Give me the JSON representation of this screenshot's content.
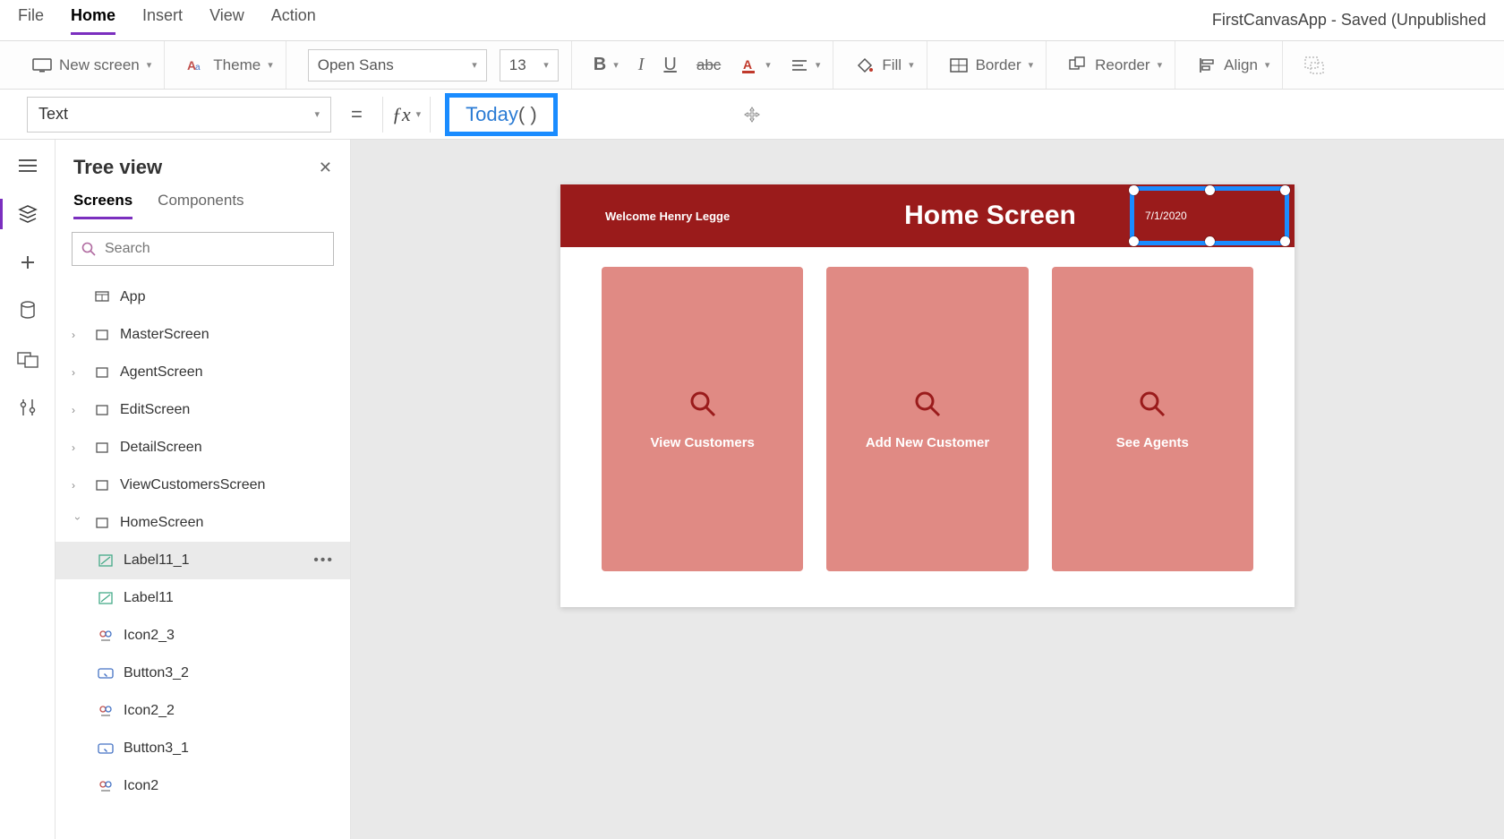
{
  "app_title": "FirstCanvasApp - Saved (Unpublished",
  "menu": {
    "file": "File",
    "home": "Home",
    "insert": "Insert",
    "view": "View",
    "action": "Action"
  },
  "ribbon": {
    "new_screen": "New screen",
    "theme": "Theme",
    "font": "Open Sans",
    "font_size": "13",
    "fill": "Fill",
    "border": "Border",
    "reorder": "Reorder",
    "align": "Align"
  },
  "formula": {
    "property": "Text",
    "fn_name": "Today",
    "parens": "( )"
  },
  "tree": {
    "title": "Tree view",
    "tabs": {
      "screens": "Screens",
      "components": "Components"
    },
    "search_placeholder": "Search",
    "app": "App",
    "screens": [
      "MasterScreen",
      "AgentScreen",
      "EditScreen",
      "DetailScreen",
      "ViewCustomersScreen",
      "HomeScreen"
    ],
    "home_children": [
      "Label11_1",
      "Label11",
      "Icon2_3",
      "Button3_2",
      "Icon2_2",
      "Button3_1",
      "Icon2"
    ]
  },
  "canvas": {
    "welcome": "Welcome Henry Legge",
    "title": "Home Screen",
    "date": "7/1/2020",
    "cards": [
      "View Customers",
      "Add New Customer",
      "See Agents"
    ]
  }
}
